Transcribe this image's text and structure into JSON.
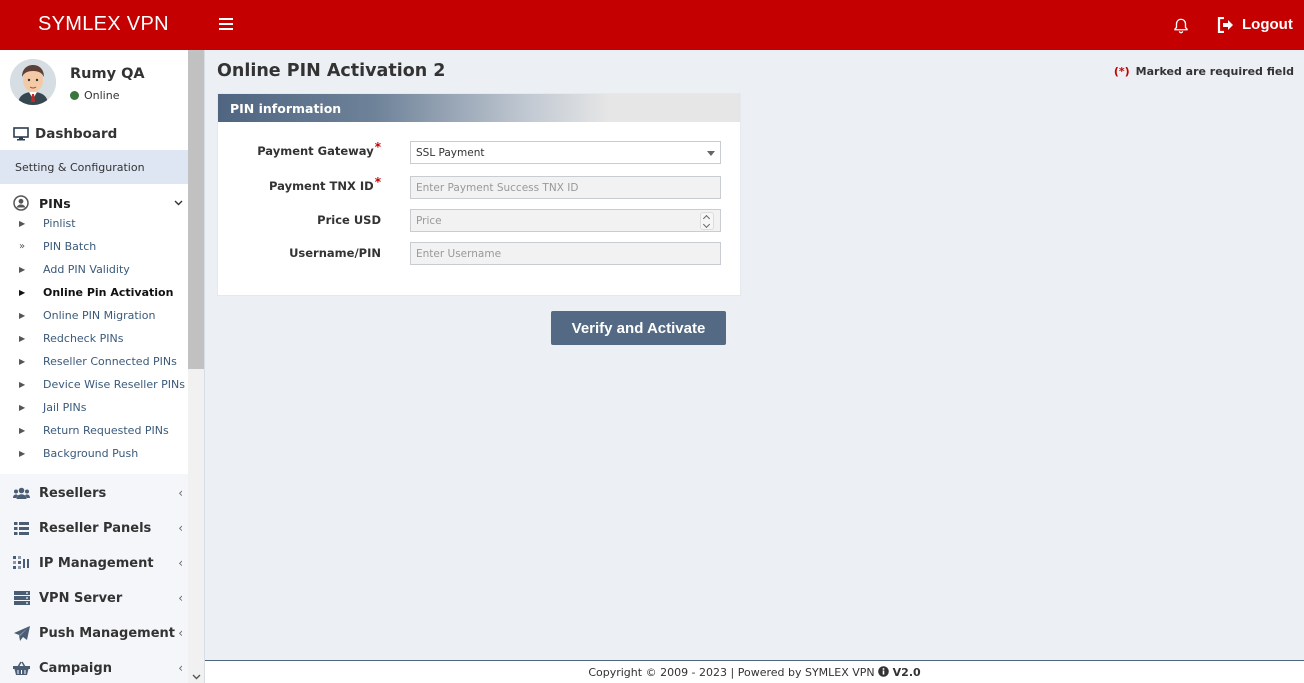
{
  "brand": "SYMLEX VPN",
  "topbar": {
    "logout_label": "Logout"
  },
  "user": {
    "name": "Rumy QA",
    "status": "Online"
  },
  "nav": {
    "dashboard": "Dashboard",
    "header": "Setting & Configuration",
    "pins": {
      "label": "PINs",
      "items": [
        "Pinlist",
        "PIN Batch",
        "Add PIN Validity",
        "Online Pin Activation",
        "Online PIN Migration",
        "Redcheck PINs",
        "Reseller Connected PINs",
        "Device Wise Reseller PINs",
        "Jail PINs",
        "Return Requested PINs",
        "Background Push"
      ]
    },
    "menus": [
      "Resellers",
      "Reseller Panels",
      "IP Management",
      "VPN Server",
      "Push Management",
      "Campaign"
    ]
  },
  "page": {
    "title": "Online PIN Activation 2",
    "required_mark": "(*)",
    "required_note": "Marked are required field"
  },
  "form": {
    "section_title": "PIN information",
    "fields": {
      "gateway": {
        "label": "Payment Gateway",
        "value": "SSL Payment"
      },
      "tnx": {
        "label": "Payment TNX ID",
        "placeholder": "Enter Payment Success TNX ID"
      },
      "price": {
        "label": "Price USD",
        "placeholder": "Price"
      },
      "username": {
        "label": "Username/PIN",
        "placeholder": "Enter Username"
      }
    },
    "submit_label": "Verify and Activate"
  },
  "footer": {
    "text": "Copyright © 2009 - 2023 | Powered by SYMLEX VPN",
    "version": "V2.0"
  },
  "colors": {
    "topbar": "#c40000",
    "button": "#546a84",
    "required": "#c40000",
    "online": "#3c763d"
  }
}
